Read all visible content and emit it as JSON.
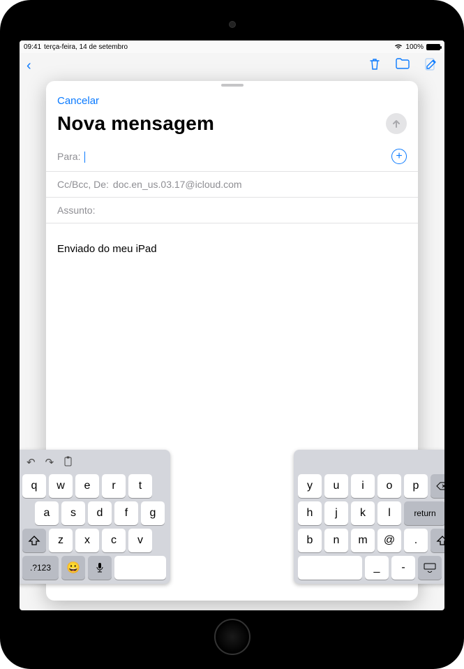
{
  "statusbar": {
    "time": "09:41",
    "date": "terça-feira, 14 de setembro",
    "battery_pct": "100%"
  },
  "underNav": {
    "trash_icon": "trash",
    "folder_icon": "folder",
    "compose_icon": "compose"
  },
  "compose": {
    "cancel": "Cancelar",
    "title": "Nova mensagem",
    "to_label": "Para:",
    "to_value": "",
    "cc_label": "Cc/Bcc, De:",
    "cc_value": "doc.en_us.03.17@icloud.com",
    "subject_label": "Assunto:",
    "subject_value": "",
    "body": "Enviado do meu iPad"
  },
  "keyboard": {
    "left": {
      "tools": [
        "undo",
        "redo",
        "clipboard"
      ],
      "row1": [
        "q",
        "w",
        "e",
        "r",
        "t"
      ],
      "row2": [
        "a",
        "s",
        "d",
        "f",
        "g"
      ],
      "row3_shift": "shift",
      "row3": [
        "z",
        "x",
        "c",
        "v"
      ],
      "row4": {
        "numkey": ".?123",
        "emoji": "😀",
        "mic": "mic"
      }
    },
    "right": {
      "row1": [
        "y",
        "u",
        "i",
        "o",
        "p"
      ],
      "row1_bksp": "backspace",
      "row2": [
        "h",
        "j",
        "k",
        "l"
      ],
      "row2_return": "return",
      "row3": [
        "b",
        "n",
        "m",
        "@",
        "."
      ],
      "row3_shift": "shift",
      "row4": {
        "punct": [
          "_",
          "-"
        ],
        "kbicon": "keyboard"
      }
    }
  }
}
